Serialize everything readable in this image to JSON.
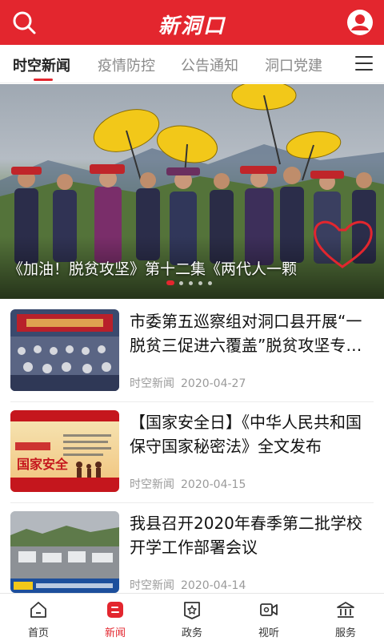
{
  "header": {
    "logo_text": "新洞口",
    "search_icon": "search-icon",
    "user_icon": "user-icon",
    "brand_color": "#e3262e"
  },
  "tabs": [
    {
      "label": "时空新闻",
      "active": true
    },
    {
      "label": "疫情防控",
      "active": false
    },
    {
      "label": "公告通知",
      "active": false
    },
    {
      "label": "洞口党建",
      "active": false
    }
  ],
  "tab_menu_icon": "hamburger-menu-icon",
  "banner": {
    "caption": "《加油！脱贫攻坚》第十二集《两代人一颗",
    "badge_text": "加油！脱贫攻坚",
    "slide_count": 5,
    "active_slide": 1
  },
  "news": [
    {
      "title": "市委第五巡察组对洞口县开展“一脱贫三促进六覆盖”脱贫攻坚专项巡察",
      "source": "时空新闻",
      "date": "2020-04-27",
      "thumb": "meeting-photo"
    },
    {
      "title": "【国家安全日】《中华人民共和国保守国家秘密法》全文发布",
      "source": "时空新闻",
      "date": "2020-04-15",
      "thumb": "national-security-poster",
      "thumb_text": "国家安全"
    },
    {
      "title": "我县召开2020年春季第二批学校开学工作部署会议",
      "source": "时空新闻",
      "date": "2020-04-14",
      "thumb": "town-street-photo"
    }
  ],
  "bottom_nav": [
    {
      "label": "首页",
      "icon": "home-icon",
      "active": false
    },
    {
      "label": "新闻",
      "icon": "news-icon",
      "active": true
    },
    {
      "label": "政务",
      "icon": "government-icon",
      "active": false
    },
    {
      "label": "视听",
      "icon": "video-icon",
      "active": false
    },
    {
      "label": "服务",
      "icon": "service-icon",
      "active": false
    }
  ]
}
